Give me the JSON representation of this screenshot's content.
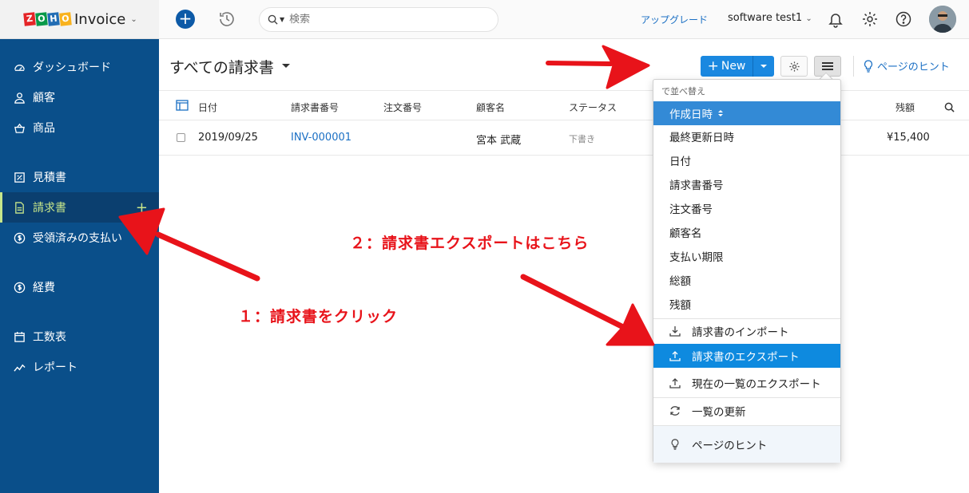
{
  "app": {
    "logo_letters": [
      "Z",
      "O",
      "H",
      "O"
    ],
    "logo_colors": [
      "#e42527",
      "#089949",
      "#226db4",
      "#f9b21d"
    ],
    "name": "Invoice"
  },
  "sidebar": {
    "items": [
      {
        "label": "ダッシュボード",
        "icon": "dashboard-icon"
      },
      {
        "label": "顧客",
        "icon": "user-icon"
      },
      {
        "label": "商品",
        "icon": "basket-icon"
      },
      {
        "label": "見積書",
        "icon": "estimate-icon"
      },
      {
        "label": "請求書",
        "icon": "document-icon",
        "active": true
      },
      {
        "label": "受領済みの支払い",
        "icon": "payment-icon"
      },
      {
        "label": "経費",
        "icon": "expense-icon"
      },
      {
        "label": "工数表",
        "icon": "calendar-icon"
      },
      {
        "label": "レポート",
        "icon": "chart-icon"
      }
    ]
  },
  "topbar": {
    "search_placeholder": "検索",
    "upgrade": "アップグレード",
    "org_name": "software test1"
  },
  "header": {
    "title": "すべての請求書",
    "new_button": "New",
    "hint": "ページのヒント"
  },
  "table": {
    "columns": [
      "日付",
      "請求書番号",
      "注文番号",
      "顧客名",
      "ステータス",
      "残額"
    ],
    "rows": [
      {
        "date": "2019/09/25",
        "number": "INV-000001",
        "order": "",
        "customer": "宮本 武蔵",
        "status": "下書き",
        "balance": "¥15,400"
      }
    ]
  },
  "menu": {
    "heading": "で並べ替え",
    "sort_items": [
      "作成日時",
      "最終更新日時",
      "日付",
      "請求書番号",
      "注文番号",
      "顧客名",
      "支払い期限",
      "総額",
      "残額"
    ],
    "import": "請求書のインポート",
    "export": "請求書のエクスポート",
    "export_current": "現在の一覧のエクスポート",
    "refresh": "一覧の更新",
    "hint": "ページのヒント"
  },
  "annotations": {
    "step1": "１：請求書をクリック",
    "step2": "２：請求書エクスポートはこちら"
  }
}
